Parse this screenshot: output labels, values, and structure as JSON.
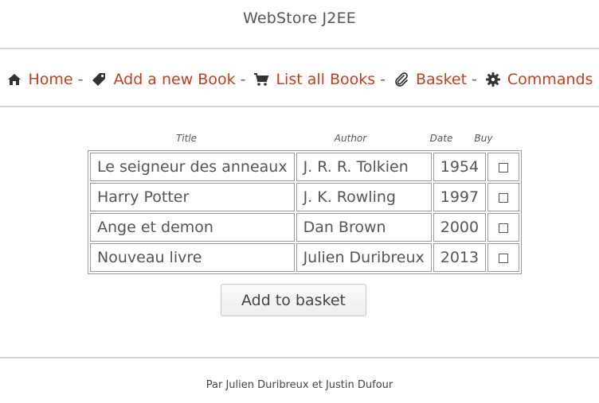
{
  "site": {
    "title": "WebStore J2EE"
  },
  "nav": {
    "items": [
      {
        "label": "Home",
        "icon": "home-icon"
      },
      {
        "label": "Add a new Book",
        "icon": "tag-icon"
      },
      {
        "label": "List all Books",
        "icon": "cart-icon"
      },
      {
        "label": "Basket",
        "icon": "paperclip-icon"
      },
      {
        "label": "Commands",
        "icon": "gear-icon"
      }
    ],
    "separator": "-"
  },
  "table": {
    "headers": [
      "Title",
      "Author",
      "Date",
      "Buy"
    ],
    "rows": [
      {
        "title": "Le seigneur des anneaux",
        "author": "J. R. R. Tolkien",
        "date": "1954"
      },
      {
        "title": "Harry Potter",
        "author": "J. K. Rowling",
        "date": "1997"
      },
      {
        "title": "Ange et demon",
        "author": "Dan Brown",
        "date": "2000"
      },
      {
        "title": "Nouveau livre",
        "author": "Julien Duribreux",
        "date": "2013"
      }
    ]
  },
  "actions": {
    "add_to_basket": "Add to basket"
  },
  "footer": {
    "credit": "Par Julien Duribreux et Justin Dufour"
  },
  "colors": {
    "link": "#c0401f",
    "text": "#555555",
    "rule": "#d4d4d4"
  }
}
